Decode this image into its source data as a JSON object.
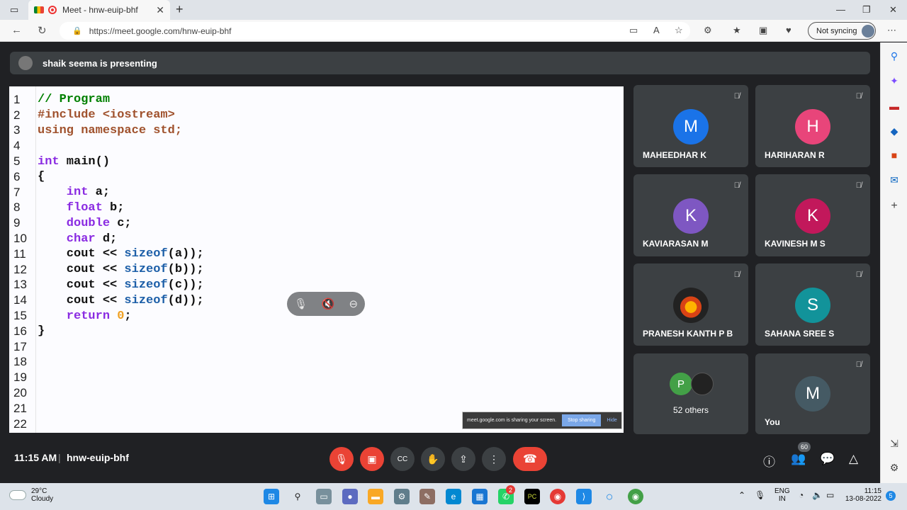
{
  "browser": {
    "tab_title": "Meet - hnw-euip-bhf",
    "url": "https://meet.google.com/hnw-euip-bhf",
    "sync_label": "Not syncing"
  },
  "meet": {
    "presenting_text": "shaik seema is presenting",
    "time": "11:15 AM",
    "meeting_code": "hnw-euip-bhf",
    "participant_count": "60",
    "share_notice": {
      "text": "meet.google.com is sharing your screen.",
      "stop_label": "Stop sharing",
      "hide_label": "Hide"
    }
  },
  "code_lines": [
    {
      "n": "1"
    },
    {
      "n": "2"
    },
    {
      "n": "3"
    },
    {
      "n": "4"
    },
    {
      "n": "5"
    },
    {
      "n": "6"
    },
    {
      "n": "7"
    },
    {
      "n": "8"
    },
    {
      "n": "9"
    },
    {
      "n": "10"
    },
    {
      "n": "11"
    },
    {
      "n": "12"
    },
    {
      "n": "13"
    },
    {
      "n": "14"
    },
    {
      "n": "15"
    },
    {
      "n": "16"
    },
    {
      "n": "17"
    },
    {
      "n": "18"
    },
    {
      "n": "19"
    },
    {
      "n": "20"
    },
    {
      "n": "21"
    },
    {
      "n": "22"
    }
  ],
  "code": {
    "l1": "// Program",
    "l2": "#include <iostream>",
    "l3": "using namespace std;",
    "l5a": "int",
    "l5b": " main()",
    "l6": "{",
    "l7a": "    int",
    "l7b": " a;",
    "l8a": "    float",
    "l8b": " b;",
    "l9a": "    double",
    "l9b": " c;",
    "l10a": "    char",
    "l10b": " d;",
    "l11a": "    cout << ",
    "l11b": "sizeof",
    "l11c": "(a));",
    "l12a": "    cout << ",
    "l12b": "sizeof",
    "l12c": "(b));",
    "l13a": "    cout << ",
    "l13b": "sizeof",
    "l13c": "(c));",
    "l14a": "    cout << ",
    "l14b": "sizeof",
    "l14c": "(d));",
    "l15a": "    return ",
    "l15b": "0",
    "l15c": ";",
    "l16": "}"
  },
  "participants": [
    {
      "initial": "M",
      "name": "MAHEEDHAR K",
      "color": "#1a73e8"
    },
    {
      "initial": "H",
      "name": "HARIHARAN R",
      "color": "#e8457a"
    },
    {
      "initial": "K",
      "name": "KAVIARASAN M",
      "color": "#7e57c2"
    },
    {
      "initial": "K",
      "name": "KAVINESH M S",
      "color": "#c2185b"
    },
    {
      "initial": "",
      "name": "PRANESH KANTH P B",
      "color": "#222222"
    },
    {
      "initial": "S",
      "name": "SAHANA SREE S",
      "color": "#12939a"
    },
    {
      "initial": "P",
      "name": "52 others",
      "color": "#43a047"
    },
    {
      "initial": "M",
      "name": "You",
      "color": "#455a64"
    }
  ],
  "taskbar": {
    "temperature": "29°C",
    "condition": "Cloudy",
    "language": "ENG",
    "region": "IN",
    "clock_time": "11:15",
    "clock_date": "13-08-2022",
    "whatsapp_badge": "2",
    "notification_count": "5"
  }
}
